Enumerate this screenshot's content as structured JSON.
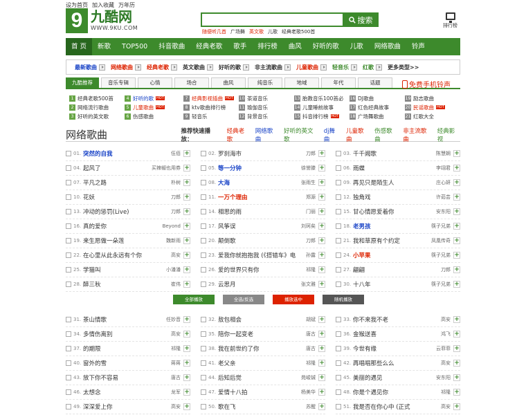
{
  "toplinks": [
    "设为首页",
    "加入收藏",
    "万年历"
  ],
  "logo": {
    "digit": "9",
    "cn": "九酷网",
    "url": "WWW.9KU.COM"
  },
  "search": {
    "button": "搜索",
    "value": ""
  },
  "hotwords": [
    "随便听几首",
    "广场舞",
    "英文歌",
    "儿歌",
    "经典老歌500首"
  ],
  "chart_link": "排行榜",
  "nav": [
    "首 页",
    "新歌",
    "TOP500",
    "抖音歌曲",
    "经典老歌",
    "歌手",
    "排行榜",
    "曲风",
    "好听的歌",
    "儿歌",
    "网络歌曲",
    "铃声"
  ],
  "cats": [
    {
      "label": "最新歌曲",
      "color": "#1a44c7"
    },
    {
      "label": "网络歌曲",
      "color": "#d20"
    },
    {
      "label": "经典老歌",
      "color": "#d20"
    },
    {
      "label": "英文歌曲",
      "color": "#333"
    },
    {
      "label": "好听的歌",
      "color": "#333"
    },
    {
      "label": "非主流歌曲",
      "color": "#333"
    },
    {
      "label": "儿童歌曲",
      "color": "#d20"
    },
    {
      "label": "轻音乐",
      "color": "#3d8a2c"
    },
    {
      "label": "红歌",
      "color": "#3d8a2c"
    }
  ],
  "more_types": "更多类型>>",
  "tabs": [
    "九酷推荐",
    "音乐专辑",
    "心情",
    "场合",
    "曲风",
    "纯音乐",
    "地域",
    "年代",
    "话题"
  ],
  "ringtone": "免费手机铃声",
  "sub": [
    [
      "1",
      "经典老歌500首"
    ],
    [
      "2",
      "网络流行歌曲"
    ],
    [
      "3",
      "好听的英文歌"
    ],
    [
      "4",
      "好听的歌"
    ],
    [
      "5",
      "儿童歌曲"
    ],
    [
      "6",
      "伤感歌曲"
    ],
    [
      "7",
      "经典影视插曲"
    ],
    [
      "8",
      "ktv歌曲排行榜"
    ],
    [
      "9",
      "轻音乐"
    ],
    [
      "10",
      "茶道音乐"
    ],
    [
      "11",
      "瑜伽音乐"
    ],
    [
      "12",
      "背景音乐"
    ],
    [
      "13",
      "胎教音乐100首必"
    ],
    [
      "14",
      "儿童睡前故事"
    ],
    [
      "15",
      "抖音排行榜"
    ],
    [
      "16",
      "DJ歌曲"
    ],
    [
      "17",
      "红色经典故事"
    ],
    [
      "18",
      "广场舞歌曲"
    ],
    [
      "19",
      "励志歌曲"
    ],
    [
      "20",
      "民谣歌曲"
    ],
    [
      "21",
      "红歌大全"
    ]
  ],
  "heading": "网络歌曲",
  "rec_label": "推荐快速播放：",
  "rec": [
    "经典老歌",
    "网络歌曲",
    "好听的英文歌",
    "dj舞曲",
    "儿童歌曲",
    "伤感歌曲",
    "非主流歌曲",
    "经典影视"
  ],
  "songs": [
    {
      "n": "01.",
      "t": "突然的自我",
      "a": "伍佰",
      "c": "blue"
    },
    {
      "n": "02.",
      "t": "罗刹海市",
      "a": "刀郎",
      "c": ""
    },
    {
      "n": "03.",
      "t": "千千阙歌",
      "a": "陈慧娴",
      "c": ""
    },
    {
      "n": "04.",
      "t": "起风了",
      "a": "买辣椒也用券",
      "c": ""
    },
    {
      "n": "05.",
      "t": "等一分钟",
      "a": "徐誉滕",
      "c": "blue"
    },
    {
      "n": "06.",
      "t": "雨蝶",
      "a": "李翊君",
      "c": ""
    },
    {
      "n": "07.",
      "t": "平凡之路",
      "a": "朴树",
      "c": ""
    },
    {
      "n": "08.",
      "t": "大海",
      "a": "张雨生",
      "c": "blue"
    },
    {
      "n": "09.",
      "t": "再见只是陌生人",
      "a": "庄心妍",
      "c": ""
    },
    {
      "n": "10.",
      "t": "花妖",
      "a": "刀郎",
      "c": ""
    },
    {
      "n": "11.",
      "t": "一万个理由",
      "a": "郑源",
      "c": "red"
    },
    {
      "n": "12.",
      "t": "独角戏",
      "a": "许茹芸",
      "c": ""
    },
    {
      "n": "13.",
      "t": "冲动的惩罚(Live)",
      "a": "刀郎",
      "c": ""
    },
    {
      "n": "14.",
      "t": "相思的雨",
      "a": "门丽",
      "c": ""
    },
    {
      "n": "15.",
      "t": "甘心情愿爱着你",
      "a": "安东阳",
      "c": ""
    },
    {
      "n": "16.",
      "t": "真的爱你",
      "a": "Beyond",
      "c": ""
    },
    {
      "n": "17.",
      "t": "风筝误",
      "a": "刘珂矣",
      "c": ""
    },
    {
      "n": "18.",
      "t": "老男孩",
      "a": "筷子兄弟",
      "c": "blue"
    },
    {
      "n": "19.",
      "t": "来生愿做一朵莲",
      "a": "魏新雨",
      "c": ""
    },
    {
      "n": "20.",
      "t": "颠倒歌",
      "a": "刀郎",
      "c": ""
    },
    {
      "n": "21.",
      "t": "我和草原有个约定",
      "a": "凤凰传奇",
      "c": ""
    },
    {
      "n": "22.",
      "t": "在心里从此永远有个你",
      "a": "高安",
      "c": ""
    },
    {
      "n": "23.",
      "t": "爱我你就抱抱我 (《搭错车》电",
      "a": "孙露",
      "c": ""
    },
    {
      "n": "24.",
      "t": "小苹果",
      "a": "筷子兄弟",
      "c": "red"
    },
    {
      "n": "25.",
      "t": "学猫叫",
      "a": "小潘潘",
      "c": ""
    },
    {
      "n": "26.",
      "t": "爱的世界只有你",
      "a": "祁隆",
      "c": ""
    },
    {
      "n": "27.",
      "t": "翩翩",
      "a": "刀郎",
      "c": ""
    },
    {
      "n": "28.",
      "t": "醉三秋",
      "a": "崔伟",
      "c": ""
    },
    {
      "n": "29.",
      "t": "云思月",
      "a": "张文雅",
      "c": ""
    },
    {
      "n": "30.",
      "t": "十八年",
      "a": "筷子兄弟",
      "c": ""
    }
  ],
  "actions": [
    "全部播放",
    "全选/反选",
    "播放选中",
    "随机播放"
  ],
  "songs2": [
    {
      "n": "31.",
      "t": "茶山情歌",
      "a": "任妙音"
    },
    {
      "n": "32.",
      "t": "敖包相会",
      "a": "胡斌"
    },
    {
      "n": "33.",
      "t": "你不来我不老",
      "a": "高安"
    },
    {
      "n": "34.",
      "t": "多情伤离别",
      "a": "高安"
    },
    {
      "n": "35.",
      "t": "陪你一起变老",
      "a": "唐古"
    },
    {
      "n": "36.",
      "t": "金猴送喜",
      "a": "鸿飞"
    },
    {
      "n": "37.",
      "t": "的期限",
      "a": "祁隆"
    },
    {
      "n": "38.",
      "t": "我在前世约了你",
      "a": "唐古"
    },
    {
      "n": "39.",
      "t": "今世有缘",
      "a": "云菲菲"
    },
    {
      "n": "40.",
      "t": "窗外的雪",
      "a": "蒋蒋"
    },
    {
      "n": "41.",
      "t": "老父亲",
      "a": "祁隆"
    },
    {
      "n": "42.",
      "t": "再唱唱那些么么",
      "a": "高安"
    },
    {
      "n": "43.",
      "t": "放下你不容易",
      "a": "唐古"
    },
    {
      "n": "44.",
      "t": "后知后觉",
      "a": "苑峻铖"
    },
    {
      "n": "45.",
      "t": "美丽的遇见",
      "a": "安东阳"
    },
    {
      "n": "46.",
      "t": "太想念",
      "a": "龙军"
    },
    {
      "n": "47.",
      "t": "爱情十八拍",
      "a": "杨美华"
    },
    {
      "n": "48.",
      "t": "你是个遇见你",
      "a": "祁隆"
    },
    {
      "n": "49.",
      "t": "深深爱上你",
      "a": "高安"
    },
    {
      "n": "50.",
      "t": "歌在飞",
      "a": "苏醒"
    },
    {
      "n": "51.",
      "t": "我是否在你心中 (正式",
      "a": "高安"
    }
  ]
}
